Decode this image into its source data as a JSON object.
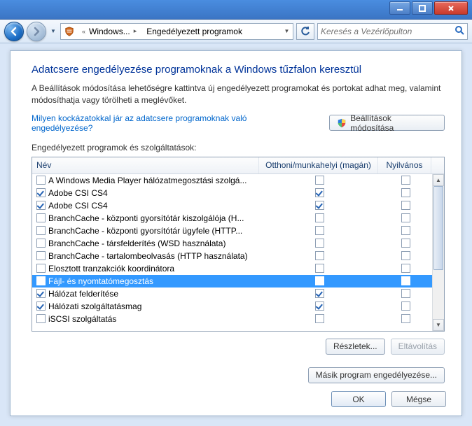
{
  "title": {
    "breadcrumb1": "Windows...",
    "breadcrumb2": "Engedélyezett programok",
    "search_placeholder": "Keresés a Vezérlőpulton"
  },
  "header": {
    "h1": "Adatcsere engedélyezése programoknak a Windows tűzfalon keresztül",
    "desc": "A Beállítások módosítása lehetőségre kattintva új engedélyezett programokat és portokat adhat meg, valamint módosíthatja vagy törölheti a meglévőket.",
    "risk_link": "Milyen kockázatokkal jár az adatcsere programoknak való engedélyezése?",
    "change_settings": "Beállítások módosítása"
  },
  "list": {
    "label": "Engedélyezett programok és szolgáltatások:",
    "col_name": "Név",
    "col_home": "Otthoni/munkahelyi (magán)",
    "col_pub": "Nyilvános",
    "rows": [
      {
        "name": "A Windows Media Player hálózatmegosztási szolgá...",
        "on": false,
        "home": false,
        "pub": false
      },
      {
        "name": "Adobe CSI CS4",
        "on": true,
        "home": true,
        "pub": false
      },
      {
        "name": "Adobe CSI CS4",
        "on": true,
        "home": true,
        "pub": false
      },
      {
        "name": "BranchCache - központi gyorsítótár kiszolgálója (H...",
        "on": false,
        "home": false,
        "pub": false
      },
      {
        "name": "BranchCache - központi gyorsítótár ügyfele (HTTP...",
        "on": false,
        "home": false,
        "pub": false
      },
      {
        "name": "BranchCache - társfelderítés (WSD használata)",
        "on": false,
        "home": false,
        "pub": false
      },
      {
        "name": "BranchCache - tartalombeolvasás (HTTP használata)",
        "on": false,
        "home": false,
        "pub": false
      },
      {
        "name": "Elosztott tranzakciók koordinátora",
        "on": false,
        "home": false,
        "pub": false
      },
      {
        "name": "Fájl- és nyomtatómegosztás",
        "on": true,
        "home": true,
        "pub": true,
        "selected": true
      },
      {
        "name": "Hálózat felderítése",
        "on": true,
        "home": true,
        "pub": false
      },
      {
        "name": "Hálózati szolgáltatásmag",
        "on": true,
        "home": true,
        "pub": false
      },
      {
        "name": "iSCSI szolgáltatás",
        "on": false,
        "home": false,
        "pub": false
      }
    ]
  },
  "buttons": {
    "details": "Részletek...",
    "remove": "Eltávolítás",
    "allow_other": "Másik program engedélyezése...",
    "ok": "OK",
    "cancel": "Mégse"
  }
}
